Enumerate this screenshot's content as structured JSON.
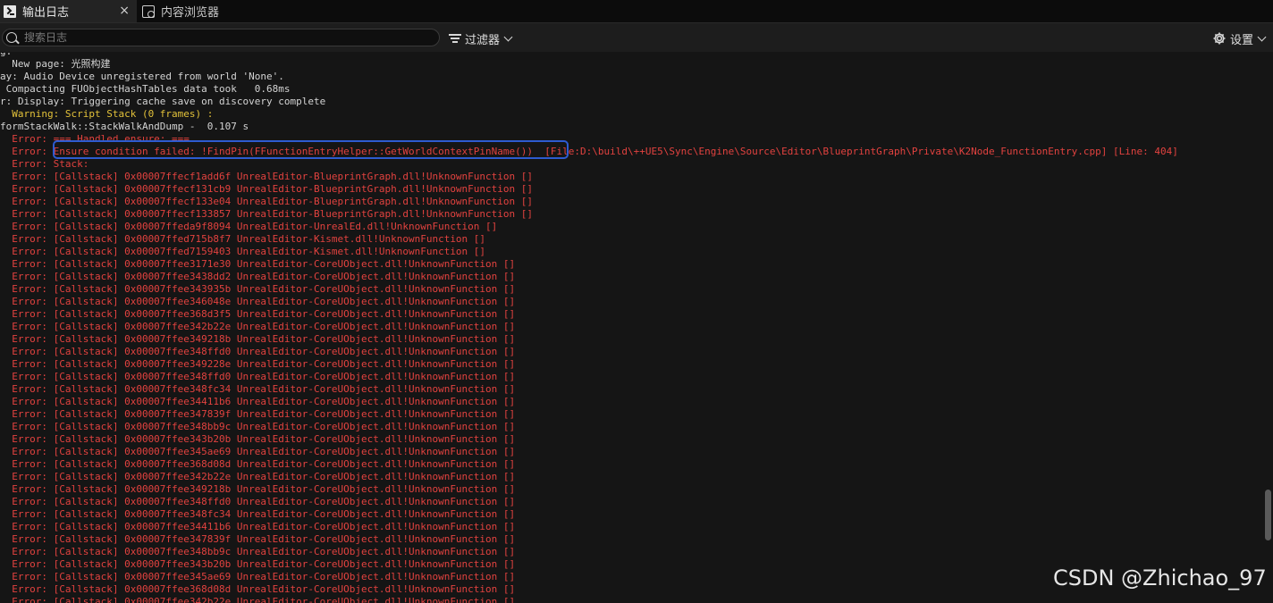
{
  "tabs": [
    {
      "label": "输出日志",
      "icon": "terminal-icon",
      "active": true,
      "close": "×"
    },
    {
      "label": "内容浏览器",
      "icon": "content-browser-icon",
      "active": false
    }
  ],
  "toolbar": {
    "search_placeholder": "搜索日志",
    "filter_label": "过滤器",
    "settings_label": "设置"
  },
  "colors": {
    "info": "#d4d4d4",
    "warning": "#e3c23a",
    "error": "#e2423f",
    "highlight_box": "#2d5bd0"
  },
  "log_lines": [
    {
      "text": "g: ‾ ‾‾‾‾",
      "level": "info"
    },
    {
      "text": "  New page: 光照构建",
      "level": "info"
    },
    {
      "text": "ay: Audio Device unregistered from world 'None'.",
      "level": "info"
    },
    {
      "text": " Compacting FUObjectHashTables data took   0.68ms",
      "level": "info"
    },
    {
      "text": "r: Display: Triggering cache save on discovery complete",
      "level": "info"
    },
    {
      "text": "  Warning: Script Stack (0 frames) :",
      "level": "warning"
    },
    {
      "text": "formStackWalk::StackWalkAndDump -  0.107 s",
      "level": "info"
    },
    {
      "text": "  Error: === Handled ensure: ===",
      "level": "error"
    },
    {
      "text": "  Error: Ensure condition failed: !FindPin(FFunctionEntryHelper::GetWorldContextPinName())  [File:D:\\build\\++UE5\\Sync\\Engine\\Source\\Editor\\BlueprintGraph\\Private\\K2Node_FunctionEntry.cpp] [Line: 404]",
      "level": "error"
    },
    {
      "text": "  Error: Stack:",
      "level": "error"
    },
    {
      "text": "  Error: [Callstack] 0x00007ffecf1add6f UnrealEditor-BlueprintGraph.dll!UnknownFunction []",
      "level": "error"
    },
    {
      "text": "  Error: [Callstack] 0x00007ffecf131cb9 UnrealEditor-BlueprintGraph.dll!UnknownFunction []",
      "level": "error"
    },
    {
      "text": "  Error: [Callstack] 0x00007ffecf133e04 UnrealEditor-BlueprintGraph.dll!UnknownFunction []",
      "level": "error"
    },
    {
      "text": "  Error: [Callstack] 0x00007ffecf133857 UnrealEditor-BlueprintGraph.dll!UnknownFunction []",
      "level": "error"
    },
    {
      "text": "  Error: [Callstack] 0x00007ffeda9f8094 UnrealEditor-UnrealEd.dll!UnknownFunction []",
      "level": "error"
    },
    {
      "text": "  Error: [Callstack] 0x00007ffed715b8f7 UnrealEditor-Kismet.dll!UnknownFunction []",
      "level": "error"
    },
    {
      "text": "  Error: [Callstack] 0x00007ffed7159403 UnrealEditor-Kismet.dll!UnknownFunction []",
      "level": "error"
    },
    {
      "text": "  Error: [Callstack] 0x00007ffee3171e30 UnrealEditor-CoreUObject.dll!UnknownFunction []",
      "level": "error"
    },
    {
      "text": "  Error: [Callstack] 0x00007ffee3438dd2 UnrealEditor-CoreUObject.dll!UnknownFunction []",
      "level": "error"
    },
    {
      "text": "  Error: [Callstack] 0x00007ffee343935b UnrealEditor-CoreUObject.dll!UnknownFunction []",
      "level": "error"
    },
    {
      "text": "  Error: [Callstack] 0x00007ffee346048e UnrealEditor-CoreUObject.dll!UnknownFunction []",
      "level": "error"
    },
    {
      "text": "  Error: [Callstack] 0x00007ffee368d3f5 UnrealEditor-CoreUObject.dll!UnknownFunction []",
      "level": "error"
    },
    {
      "text": "  Error: [Callstack] 0x00007ffee342b22e UnrealEditor-CoreUObject.dll!UnknownFunction []",
      "level": "error"
    },
    {
      "text": "  Error: [Callstack] 0x00007ffee349218b UnrealEditor-CoreUObject.dll!UnknownFunction []",
      "level": "error"
    },
    {
      "text": "  Error: [Callstack] 0x00007ffee348ffd0 UnrealEditor-CoreUObject.dll!UnknownFunction []",
      "level": "error"
    },
    {
      "text": "  Error: [Callstack] 0x00007ffee349228e UnrealEditor-CoreUObject.dll!UnknownFunction []",
      "level": "error"
    },
    {
      "text": "  Error: [Callstack] 0x00007ffee348ffd0 UnrealEditor-CoreUObject.dll!UnknownFunction []",
      "level": "error"
    },
    {
      "text": "  Error: [Callstack] 0x00007ffee348fc34 UnrealEditor-CoreUObject.dll!UnknownFunction []",
      "level": "error"
    },
    {
      "text": "  Error: [Callstack] 0x00007ffee34411b6 UnrealEditor-CoreUObject.dll!UnknownFunction []",
      "level": "error"
    },
    {
      "text": "  Error: [Callstack] 0x00007ffee347839f UnrealEditor-CoreUObject.dll!UnknownFunction []",
      "level": "error"
    },
    {
      "text": "  Error: [Callstack] 0x00007ffee348bb9c UnrealEditor-CoreUObject.dll!UnknownFunction []",
      "level": "error"
    },
    {
      "text": "  Error: [Callstack] 0x00007ffee343b20b UnrealEditor-CoreUObject.dll!UnknownFunction []",
      "level": "error"
    },
    {
      "text": "  Error: [Callstack] 0x00007ffee345ae69 UnrealEditor-CoreUObject.dll!UnknownFunction []",
      "level": "error"
    },
    {
      "text": "  Error: [Callstack] 0x00007ffee368d08d UnrealEditor-CoreUObject.dll!UnknownFunction []",
      "level": "error"
    },
    {
      "text": "  Error: [Callstack] 0x00007ffee342b22e UnrealEditor-CoreUObject.dll!UnknownFunction []",
      "level": "error"
    },
    {
      "text": "  Error: [Callstack] 0x00007ffee349218b UnrealEditor-CoreUObject.dll!UnknownFunction []",
      "level": "error"
    },
    {
      "text": "  Error: [Callstack] 0x00007ffee348ffd0 UnrealEditor-CoreUObject.dll!UnknownFunction []",
      "level": "error"
    },
    {
      "text": "  Error: [Callstack] 0x00007ffee348fc34 UnrealEditor-CoreUObject.dll!UnknownFunction []",
      "level": "error"
    },
    {
      "text": "  Error: [Callstack] 0x00007ffee34411b6 UnrealEditor-CoreUObject.dll!UnknownFunction []",
      "level": "error"
    },
    {
      "text": "  Error: [Callstack] 0x00007ffee347839f UnrealEditor-CoreUObject.dll!UnknownFunction []",
      "level": "error"
    },
    {
      "text": "  Error: [Callstack] 0x00007ffee348bb9c UnrealEditor-CoreUObject.dll!UnknownFunction []",
      "level": "error"
    },
    {
      "text": "  Error: [Callstack] 0x00007ffee343b20b UnrealEditor-CoreUObject.dll!UnknownFunction []",
      "level": "error"
    },
    {
      "text": "  Error: [Callstack] 0x00007ffee345ae69 UnrealEditor-CoreUObject.dll!UnknownFunction []",
      "level": "error"
    },
    {
      "text": "  Error: [Callstack] 0x00007ffee368d08d UnrealEditor-CoreUObject.dll!UnknownFunction []",
      "level": "error"
    },
    {
      "text": "  Error: [Callstack] 0x00007ffee342b22e UnrealEditor-CoreUObject.dll!UnknownFunction []",
      "level": "error"
    }
  ],
  "watermark": "CSDN @Zhichao_97"
}
